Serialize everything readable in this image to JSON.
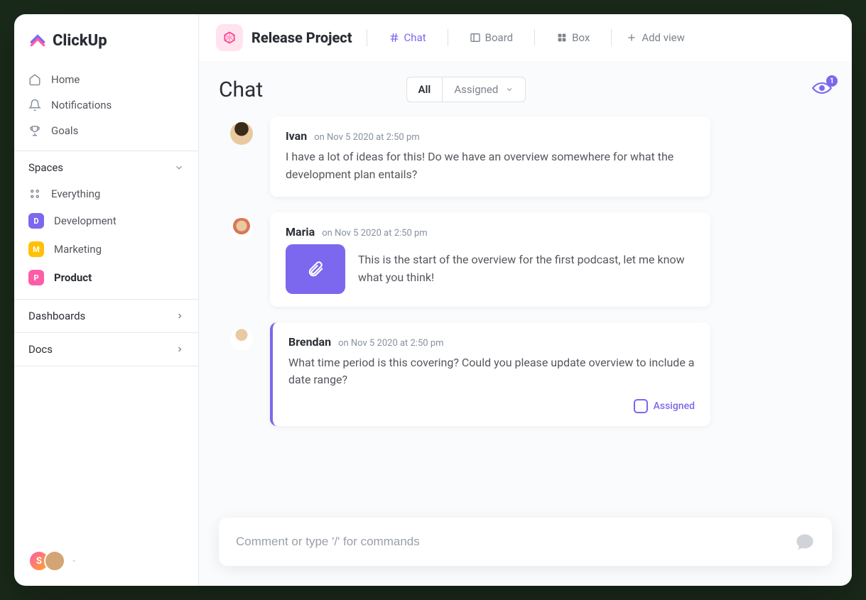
{
  "brand": "ClickUp",
  "nav": {
    "home": "Home",
    "notifications": "Notifications",
    "goals": "Goals"
  },
  "spaces": {
    "header": "Spaces",
    "everything": "Everything",
    "items": [
      {
        "letter": "D",
        "label": "Development",
        "color": "#7b68ee"
      },
      {
        "letter": "M",
        "label": "Marketing",
        "color": "#ffc107"
      },
      {
        "letter": "P",
        "label": "Product",
        "color": "#ff5ca8"
      }
    ]
  },
  "sidebar_footer": {
    "dashboards": "Dashboards",
    "docs": "Docs",
    "user_initial": "S"
  },
  "project": {
    "title": "Release Project",
    "views": {
      "chat": "Chat",
      "board": "Board",
      "box": "Box",
      "add": "Add view"
    }
  },
  "chat": {
    "title": "Chat",
    "filters": {
      "all": "All",
      "assigned": "Assigned"
    },
    "watchers": "1",
    "messages": [
      {
        "author": "Ivan",
        "time": "on Nov 5 2020 at 2:50 pm",
        "body": "I have a lot of ideas for this! Do we have an overview somewhere for what the development plan entails?"
      },
      {
        "author": "Maria",
        "time": "on Nov 5 2020 at 2:50 pm",
        "body": "This is the start of the overview for the first podcast, let me know what you think!"
      },
      {
        "author": "Brendan",
        "time": "on Nov 5 2020 at 2:50 pm",
        "body": "What time period is this covering? Could you please update overview to include a date range?",
        "assigned_label": "Assigned"
      }
    ],
    "composer_placeholder": "Comment or type '/' for commands"
  }
}
